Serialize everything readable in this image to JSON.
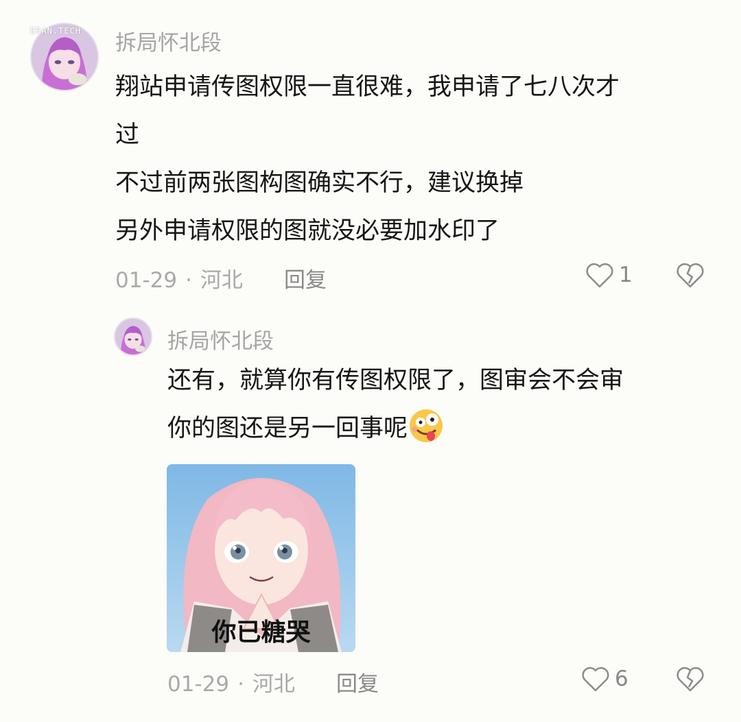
{
  "watermark": "ERAN.TECH",
  "comment": {
    "username": "拆局怀北段",
    "lines": [
      "翔站申请传图权限一直很难，我申请了七八次才",
      "过",
      "不过前两张图构图确实不行，建议换掉",
      "另外申请权限的图就没必要加水印了"
    ],
    "date": "01-29",
    "separator": "·",
    "location": "河北",
    "reply_label": "回复",
    "like_count": "1"
  },
  "reply": {
    "username": "拆局怀北段",
    "lines": [
      "还有，就算你有传图权限了，图审会不会审",
      "你的图还是另一回事呢"
    ],
    "emoji": "zany-face-emoji",
    "sticker_caption": "你已糖哭",
    "date": "01-29",
    "separator": "·",
    "location": "河北",
    "reply_label": "回复",
    "like_count": "6"
  },
  "icons": {
    "like": "heart-outline-icon",
    "dislike": "broken-heart-icon"
  },
  "colors": {
    "background": "#fcfcf8",
    "username": "#a5a5a5",
    "meta": "#a9a9a9",
    "text": "#161616"
  }
}
